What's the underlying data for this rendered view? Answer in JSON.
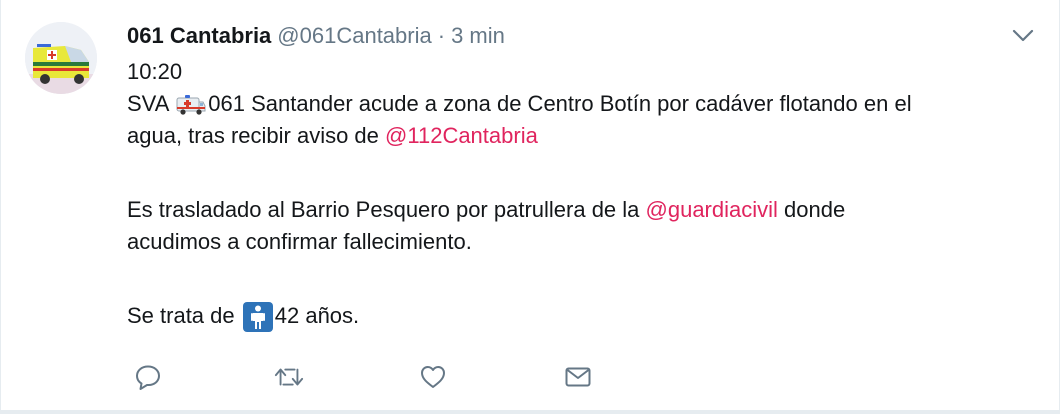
{
  "tweet": {
    "author": {
      "name": "061 Cantabria",
      "handle": "@061Cantabria"
    },
    "separator": "·",
    "time_ago": "3 min",
    "lines": {
      "l1": "10:20",
      "l2_a": "SVA ",
      "l2_b": "061 Santander acude a zona de Centro Botín por cadáver flotando en el",
      "l3_a": "agua, tras recibir aviso de ",
      "l3_mention": "@112Cantabria",
      "l4_a": "Es trasladado al Barrio Pesquero por patrullera de la ",
      "l4_mention": "@guardiacivil",
      "l4_b": " donde",
      "l5": "acudimos a confirmar fallecimiento.",
      "l6_a": "Se trata de ",
      "l6_b": "42 años."
    },
    "icons": {
      "ambulance_emoji": "ambulance-emoji",
      "man_emoji": "man-emoji"
    },
    "actions": [
      "reply-icon",
      "retweet-icon",
      "like-icon",
      "message-icon"
    ]
  },
  "colors": {
    "text": "#14171a",
    "muted": "#657786",
    "mention": "#e0245e",
    "icon": "#657786"
  }
}
